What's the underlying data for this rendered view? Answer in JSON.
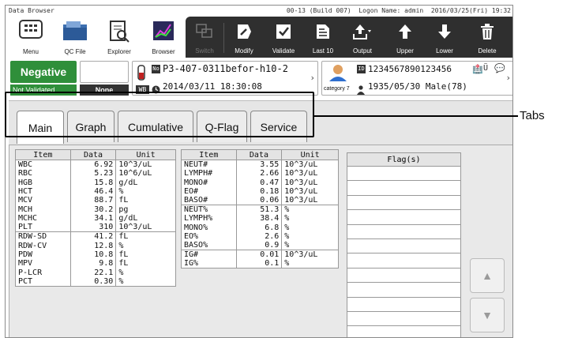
{
  "statusbar": {
    "app_name": "Data Browser",
    "info": "00-13 (Build 007)  Logon Name: admin  2016/03/25(Fri) 19:32"
  },
  "toolbar": {
    "left_buttons": [
      {
        "label": "Menu",
        "icon": "menu-icon"
      },
      {
        "label": "QC File",
        "icon": "qc-file-icon"
      },
      {
        "label": "Explorer",
        "icon": "explorer-icon"
      },
      {
        "label": "Browser",
        "icon": "browser-icon"
      }
    ],
    "right_buttons": [
      {
        "label": "Switch",
        "icon": "switch-icon",
        "enabled": false
      },
      {
        "label": "Modify",
        "icon": "modify-icon",
        "enabled": true
      },
      {
        "label": "Validate",
        "icon": "validate-icon",
        "enabled": true
      },
      {
        "label": "Last 10",
        "icon": "last10-icon",
        "enabled": true
      },
      {
        "label": "Output",
        "icon": "output-icon",
        "enabled": true
      },
      {
        "label": "Upper",
        "icon": "arrow-up-icon",
        "enabled": true
      },
      {
        "label": "Lower",
        "icon": "arrow-down-icon",
        "enabled": true
      },
      {
        "label": "Delete",
        "icon": "trash-icon",
        "enabled": true
      }
    ]
  },
  "sample": {
    "status": "Negative",
    "status_sub": "Not Validated",
    "none_label": "None",
    "sample_no": "P3-407-0311befor-h10-2",
    "datetime": "2014/03/11 18:30:08",
    "tube_code": "WB",
    "patient_id": "1234567890123456",
    "category": "category 7",
    "birth_info": "1935/05/30 Male(78)",
    "colors": {
      "status": "#2f8f3a",
      "toolbar": "#2f2f2f"
    }
  },
  "tabs": [
    {
      "label": "Main",
      "active": true
    },
    {
      "label": "Graph",
      "active": false
    },
    {
      "label": "Cumulative",
      "active": false
    },
    {
      "label": "Q-Flag",
      "active": false
    },
    {
      "label": "Service",
      "active": false
    }
  ],
  "callout": {
    "label": "Tabs"
  },
  "table1": {
    "headers": [
      "Item",
      "Data",
      "Unit"
    ],
    "rows": [
      [
        "WBC",
        "6.92",
        "10^3/uL"
      ],
      [
        "RBC",
        "5.23",
        "10^6/uL"
      ],
      [
        "HGB",
        "15.8",
        "g/dL"
      ],
      [
        "HCT",
        "46.4",
        "%"
      ],
      [
        "MCV",
        "88.7",
        "fL"
      ],
      [
        "MCH",
        "30.2",
        "pg"
      ],
      [
        "MCHC",
        "34.1",
        "g/dL"
      ],
      [
        "PLT",
        "310",
        "10^3/uL"
      ],
      [
        "RDW-SD",
        "41.2",
        "fL"
      ],
      [
        "RDW-CV",
        "12.8",
        "%"
      ],
      [
        "PDW",
        "10.8",
        "fL"
      ],
      [
        "MPV",
        "9.8",
        "fL"
      ],
      [
        "P-LCR",
        "22.1",
        "%"
      ],
      [
        "PCT",
        "0.30",
        "%"
      ]
    ]
  },
  "table2": {
    "headers": [
      "Item",
      "Data",
      "Unit"
    ],
    "rows": [
      [
        "NEUT#",
        "3.55",
        "10^3/uL"
      ],
      [
        "LYMPH#",
        "2.66",
        "10^3/uL"
      ],
      [
        "MONO#",
        "0.47",
        "10^3/uL"
      ],
      [
        "EO#",
        "0.18",
        "10^3/uL"
      ],
      [
        "BASO#",
        "0.06",
        "10^3/uL"
      ],
      [
        "NEUT%",
        "51.3",
        "%"
      ],
      [
        "LYMPH%",
        "38.4",
        "%"
      ],
      [
        "MONO%",
        "6.8",
        "%"
      ],
      [
        "EO%",
        "2.6",
        "%"
      ],
      [
        "BASO%",
        "0.9",
        "%"
      ],
      [
        "IG#",
        "0.01",
        "10^3/uL"
      ],
      [
        "IG%",
        "0.1",
        "%"
      ]
    ]
  },
  "flags": {
    "header": "Flag(s)"
  }
}
